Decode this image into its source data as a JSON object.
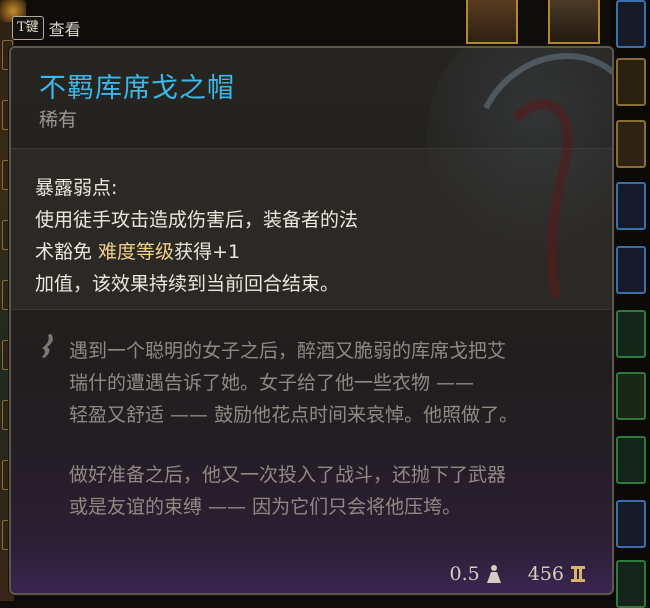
{
  "hint": {
    "key": "T键",
    "label": "查看"
  },
  "item": {
    "name": "不羁库席戈之帽",
    "rarity": "稀有"
  },
  "passive": {
    "title": "暴露弱点:",
    "line1": "使用徒手攻击造成伤害后，装备者的法",
    "line2_prefix": "术豁免 ",
    "line2_highlight": "难度等级",
    "line2_suffix": "获得+1",
    "line3": "加值，该效果持续到当前回合结束。"
  },
  "flavor": {
    "lines": [
      "遇到一个聪明的女子之后，醉酒又脆弱的库席戈把艾",
      "瑞什的遭遇告诉了她。女子给了他一些衣物 ——",
      "轻盈又舒适 —— 鼓励他花点时间来哀悼。他照做了。",
      "做好准备之后，他又一次投入了战斗，还抛下了武器",
      "或是友谊的束缚 —— 因为它们只会将他压垮。"
    ]
  },
  "stats": {
    "weight": "0.5",
    "weight_icon": "weight-icon",
    "value": "456",
    "value_icon": "gold-coin-icon"
  },
  "colors": {
    "title": "#3bb7e8",
    "highlight": "#f0cf8c",
    "flavor": "#8f8982"
  }
}
